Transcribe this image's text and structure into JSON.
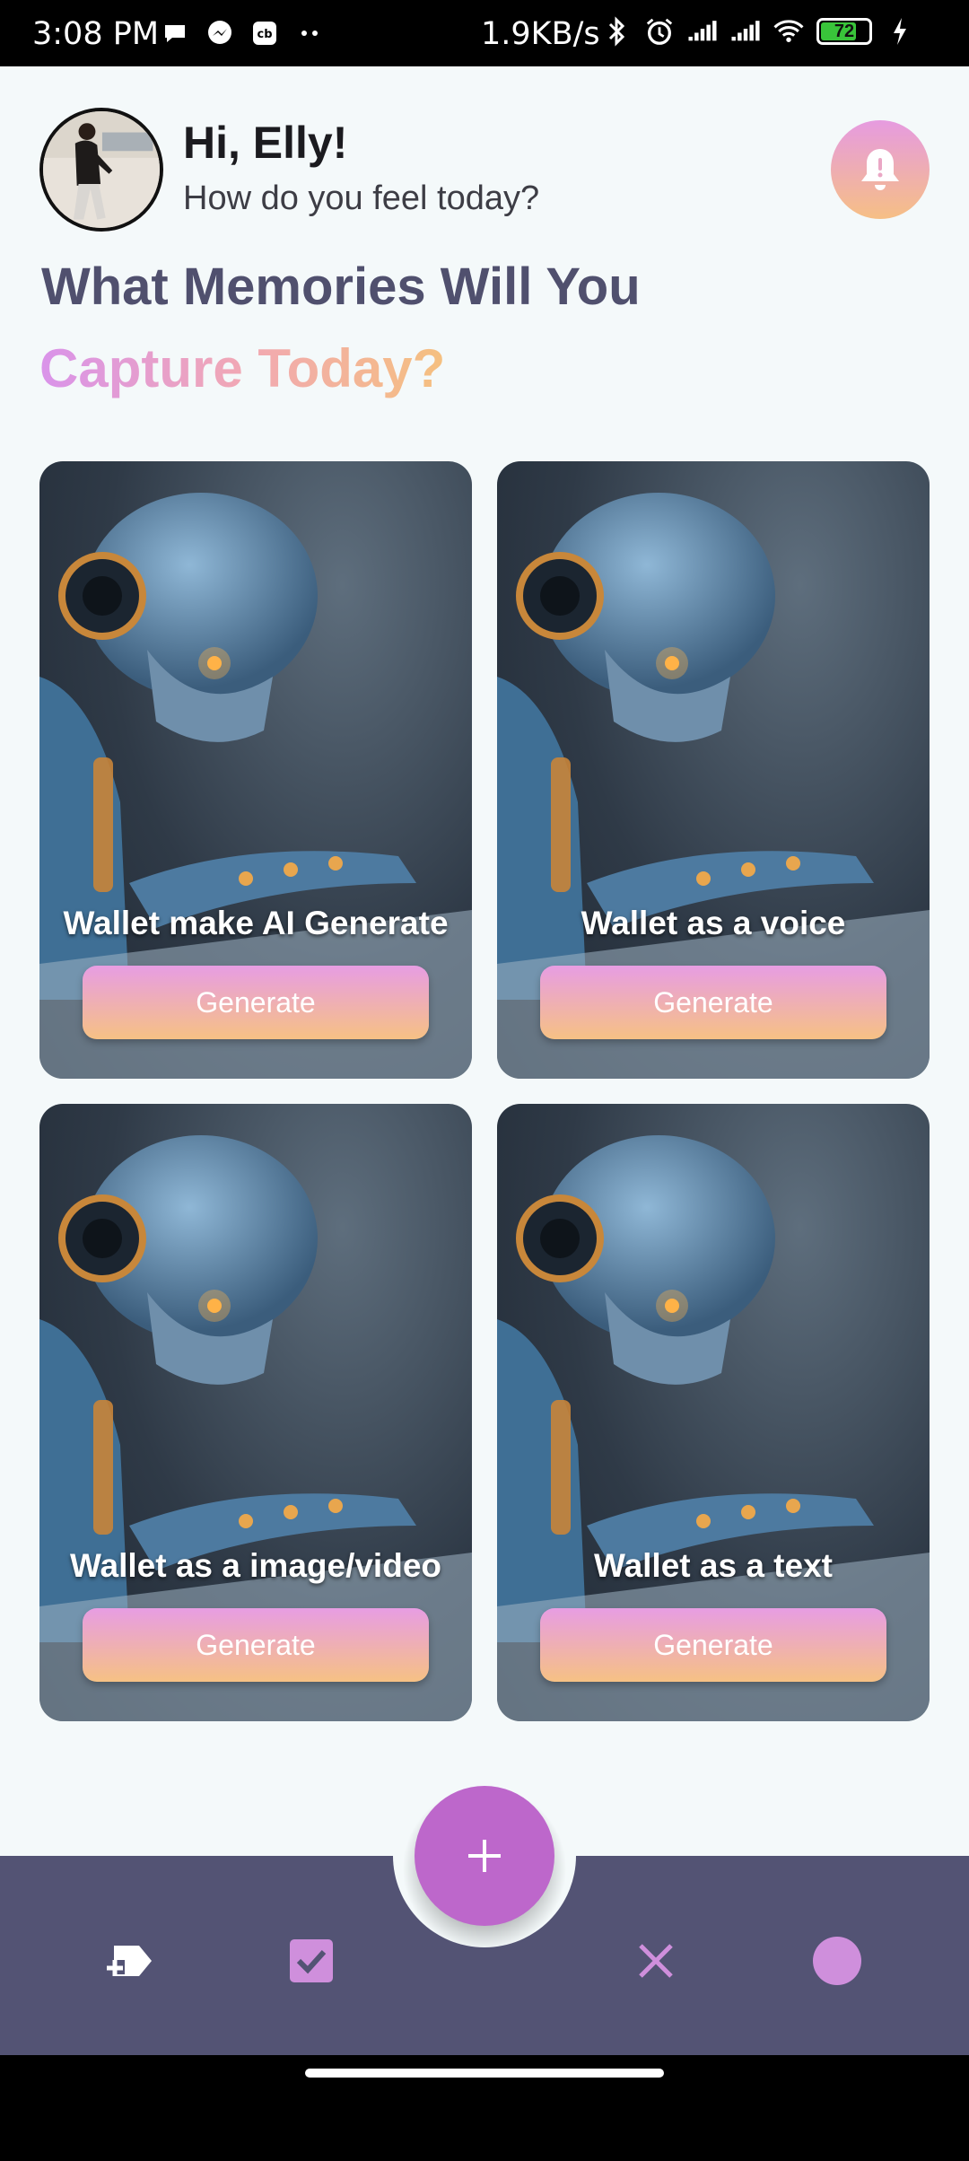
{
  "status_bar": {
    "time": "3:08 PM",
    "network_speed": "1.9KB/s",
    "battery_level": "72",
    "left_icons": [
      "chat-bubble-icon",
      "messenger-icon",
      "cb-icon",
      "more-dots-icon"
    ],
    "right_icons": [
      "bluetooth-icon",
      "alarm-icon",
      "signal-icon",
      "signal-icon",
      "wifi-icon",
      "battery-icon",
      "charging-icon"
    ]
  },
  "header": {
    "greeting": "Hi, Elly!",
    "subtitle": "How do you feel today?",
    "bell_icon": "bell-icon"
  },
  "headline": {
    "line1": "What Memories Will You",
    "line2": "Capture Today?"
  },
  "cards": [
    {
      "title": "Wallet make AI Generate",
      "button_label": "Generate"
    },
    {
      "title": "Wallet as a voice",
      "button_label": "Generate"
    },
    {
      "title": "Wallet as a image/video",
      "button_label": "Generate"
    },
    {
      "title": "Wallet as a text",
      "button_label": "Generate"
    }
  ],
  "bottom_nav": {
    "fab_icon": "plus-icon",
    "items": [
      "label-add-icon",
      "checkbox-icon",
      "close-icon",
      "circle-icon"
    ]
  },
  "colors": {
    "nav_background": "#535374",
    "fab": "#bd67cb",
    "gradient_start": "#e79de3",
    "gradient_end": "#f6c184",
    "headline_dark": "#50506e"
  }
}
